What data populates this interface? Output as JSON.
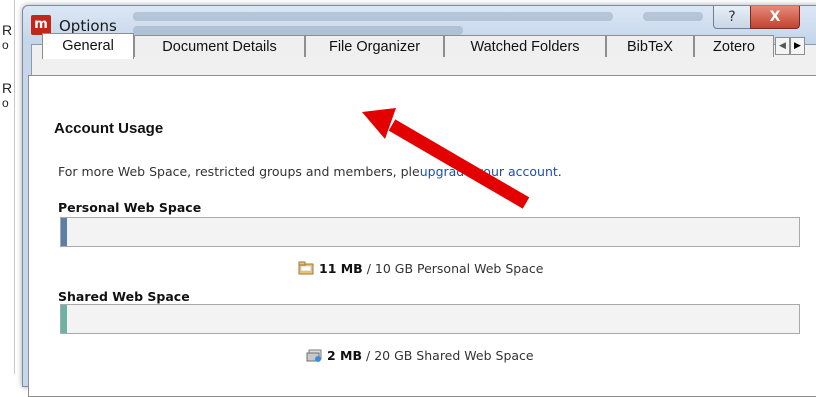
{
  "window": {
    "title": "Options",
    "app_icon_letter": "m",
    "help_glyph": "?",
    "close_glyph": "X"
  },
  "background": {
    "left_letters": [
      "R",
      "R"
    ],
    "right_letters": [
      "o",
      "o"
    ]
  },
  "tabs": [
    {
      "label": "General",
      "active": true
    },
    {
      "label": "Document Details",
      "active": false
    },
    {
      "label": "File Organizer",
      "active": false
    },
    {
      "label": "Watched Folders",
      "active": false
    },
    {
      "label": "BibTeX",
      "active": false
    },
    {
      "label": "Zotero",
      "active": false
    }
  ],
  "tab_scroll": {
    "left_glyph": "◀",
    "right_glyph": "▶"
  },
  "account": {
    "heading": "Account Usage",
    "description_prefix": "For more Web Space, restricted groups and members, ple",
    "description_link": "upgrade your account",
    "description_suffix": "."
  },
  "personal": {
    "label": "Personal Web Space",
    "used": "11 MB",
    "total_text": " / 10 GB Personal Web Space",
    "fill_fraction": 0.0011,
    "fill_color": "#5b7fa6"
  },
  "shared": {
    "label": "Shared Web Space",
    "used": "2 MB",
    "total_text": " / 20 GB Shared Web Space",
    "fill_fraction": 0.0001,
    "fill_color": "#6bb4a4"
  },
  "annotation": {
    "arrow_color": "#e30000"
  }
}
